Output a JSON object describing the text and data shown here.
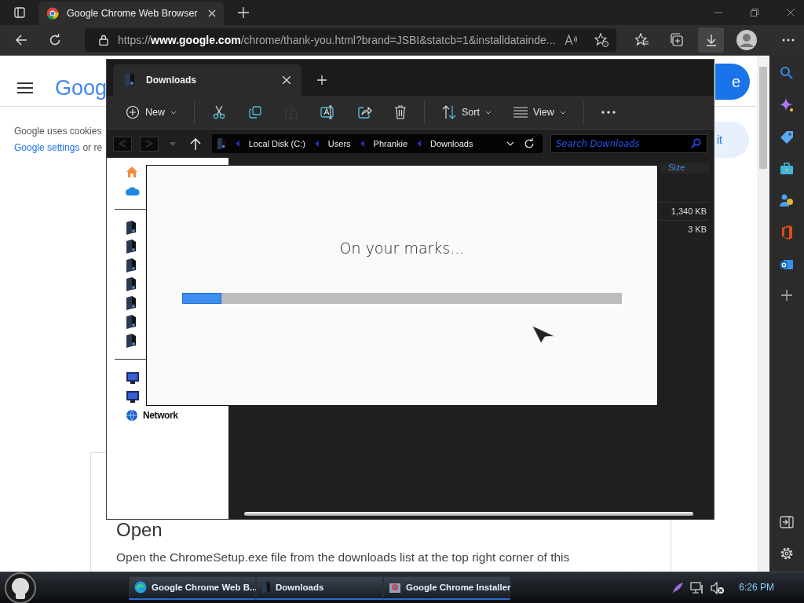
{
  "browser": {
    "tab": {
      "title": "Google Chrome Web Browser"
    },
    "address": "https://**www.google.com**/chrome/thank-you.html?brand=JSBI&statcb=1&installdatainde...",
    "page": {
      "logo": "Goog",
      "cookie_text": "Google uses cookies",
      "cookie_link": "Google settings",
      "cookie_rest": "or re",
      "button_partial": "e",
      "chip_partial": "it",
      "heading": "Open",
      "paragraph": "Open the ChromeSetup.exe file from the downloads list at the top right corner of this"
    }
  },
  "explorer": {
    "tab": "Downloads",
    "toolbar": [
      {
        "kind": "new",
        "label": "New",
        "disabled": false
      },
      {
        "kind": "cut",
        "disabled": false
      },
      {
        "kind": "copy",
        "disabled": false
      },
      {
        "kind": "paste",
        "disabled": true
      },
      {
        "kind": "rename",
        "disabled": false
      },
      {
        "kind": "share",
        "disabled": false
      },
      {
        "kind": "delete",
        "disabled": false
      },
      {
        "kind": "sort",
        "label": "Sort",
        "disabled": false
      },
      {
        "kind": "view",
        "label": "View",
        "disabled": false
      },
      {
        "kind": "more",
        "disabled": false
      }
    ],
    "breadcrumbs": [
      "Local Disk (C:)",
      "Users",
      "Phrankie",
      "Downloads"
    ],
    "search_placeholder": "Search Downloads",
    "nav_groups": [
      [
        {
          "kind": "home"
        },
        {
          "kind": "cloud"
        }
      ],
      [
        {
          "kind": "folder"
        },
        {
          "kind": "folder"
        },
        {
          "kind": "folder"
        },
        {
          "kind": "folder"
        },
        {
          "kind": "folder"
        },
        {
          "kind": "folder"
        },
        {
          "kind": "folder"
        }
      ],
      [
        {
          "kind": "device"
        },
        {
          "kind": "device"
        },
        {
          "kind": "network",
          "label": "Network"
        }
      ]
    ],
    "size_header": "Size",
    "sizes": [
      "1,340 KB",
      "3 KB"
    ]
  },
  "dialog": {
    "message": "On your marks...",
    "level": 0.09
  },
  "taskbar": {
    "items": [
      {
        "kind": "edge",
        "label": "Google Chrome Web B..."
      },
      {
        "kind": "explorer",
        "label": "Downloads"
      },
      {
        "kind": "installer",
        "label": "Google Chrome Installer"
      }
    ],
    "clock": "6:26 PM"
  }
}
